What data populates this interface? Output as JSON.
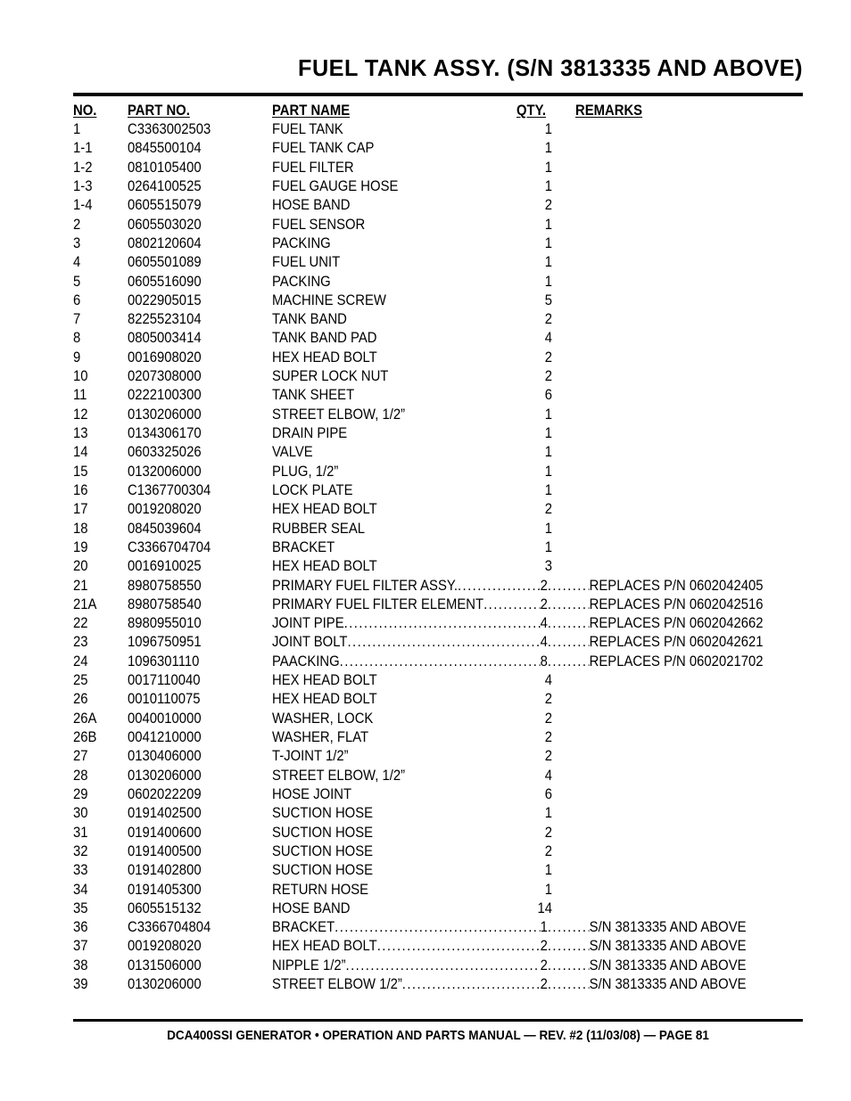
{
  "page": {
    "title": "FUEL TANK ASSY. (S/N 3813335 AND ABOVE)",
    "footer": "DCA400SSI GENERATOR • OPERATION AND PARTS MANUAL — REV. #2 (11/03/08) — PAGE 81"
  },
  "table": {
    "headers": {
      "no": "NO.",
      "part_no": "PART NO.",
      "part_name": "PART NAME",
      "qty": "QTY.",
      "remarks": "REMARKS"
    },
    "rows": [
      {
        "no": "1",
        "part_no": "C3363002503",
        "part_name": "FUEL TANK",
        "qty": "1",
        "remarks": ""
      },
      {
        "no": "1-1",
        "part_no": "0845500104",
        "part_name": "FUEL TANK CAP",
        "qty": "1",
        "remarks": ""
      },
      {
        "no": "1-2",
        "part_no": "0810105400",
        "part_name": "FUEL FILTER",
        "qty": "1",
        "remarks": ""
      },
      {
        "no": "1-3",
        "part_no": "0264100525",
        "part_name": "FUEL GAUGE HOSE",
        "qty": "1",
        "remarks": ""
      },
      {
        "no": "1-4",
        "part_no": "0605515079",
        "part_name": "HOSE BAND",
        "qty": "2",
        "remarks": ""
      },
      {
        "no": "2",
        "part_no": "0605503020",
        "part_name": "FUEL SENSOR",
        "qty": "1",
        "remarks": ""
      },
      {
        "no": "3",
        "part_no": "0802120604",
        "part_name": "PACKING",
        "qty": "1",
        "remarks": ""
      },
      {
        "no": "4",
        "part_no": "0605501089",
        "part_name": "FUEL UNIT",
        "qty": "1",
        "remarks": ""
      },
      {
        "no": "5",
        "part_no": "0605516090",
        "part_name": "PACKING",
        "qty": "1",
        "remarks": ""
      },
      {
        "no": "6",
        "part_no": "0022905015",
        "part_name": "MACHINE SCREW",
        "qty": "5",
        "remarks": ""
      },
      {
        "no": "7",
        "part_no": "8225523104",
        "part_name": "TANK BAND",
        "qty": "2",
        "remarks": ""
      },
      {
        "no": "8",
        "part_no": "0805003414",
        "part_name": "TANK BAND PAD",
        "qty": "4",
        "remarks": ""
      },
      {
        "no": "9",
        "part_no": "0016908020",
        "part_name": "HEX HEAD BOLT",
        "qty": "2",
        "remarks": ""
      },
      {
        "no": "10",
        "part_no": "0207308000",
        "part_name": "SUPER LOCK NUT",
        "qty": "2",
        "remarks": ""
      },
      {
        "no": "11",
        "part_no": "0222100300",
        "part_name": "TANK SHEET",
        "qty": "6",
        "remarks": ""
      },
      {
        "no": "12",
        "part_no": "0130206000",
        "part_name": "STREET ELBOW, 1/2”",
        "qty": "1",
        "remarks": ""
      },
      {
        "no": "13",
        "part_no": "0134306170",
        "part_name": "DRAIN PIPE",
        "qty": "1",
        "remarks": ""
      },
      {
        "no": "14",
        "part_no": "0603325026",
        "part_name": "VALVE",
        "qty": "1",
        "remarks": ""
      },
      {
        "no": "15",
        "part_no": "0132006000",
        "part_name": "PLUG, 1/2”",
        "qty": "1",
        "remarks": ""
      },
      {
        "no": "16",
        "part_no": "C1367700304",
        "part_name": "LOCK PLATE",
        "qty": "1",
        "remarks": ""
      },
      {
        "no": "17",
        "part_no": "0019208020",
        "part_name": "HEX HEAD BOLT",
        "qty": "2",
        "remarks": ""
      },
      {
        "no": "18",
        "part_no": "0845039604",
        "part_name": "RUBBER SEAL",
        "qty": "1",
        "remarks": ""
      },
      {
        "no": "19",
        "part_no": "C3366704704",
        "part_name": "BRACKET",
        "qty": "1",
        "remarks": ""
      },
      {
        "no": "20",
        "part_no": "0016910025",
        "part_name": "HEX HEAD BOLT",
        "qty": "3",
        "remarks": ""
      },
      {
        "no": "21",
        "part_no": "8980758550",
        "part_name": "PRIMARY FUEL FILTER ASSY.",
        "qty": "2",
        "remarks": "REPLACES P/N 0602042405",
        "leader": true
      },
      {
        "no": "21A",
        "part_no": "8980758540",
        "part_name": "PRIMARY FUEL FILTER ELEMENT",
        "qty": "2",
        "remarks": "REPLACES P/N 0602042516",
        "leader": true
      },
      {
        "no": "22",
        "part_no": "8980955010",
        "part_name": "JOINT PIPE",
        "qty": "4",
        "remarks": "REPLACES P/N 0602042662",
        "leader": true
      },
      {
        "no": "23",
        "part_no": "1096750951",
        "part_name": "JOINT BOLT",
        "qty": "4",
        "remarks": "REPLACES P/N 0602042621",
        "leader": true
      },
      {
        "no": "24",
        "part_no": "1096301110",
        "part_name": "PAACKING",
        "qty": "8",
        "remarks": "REPLACES P/N 0602021702",
        "leader": true
      },
      {
        "no": "25",
        "part_no": "0017110040",
        "part_name": "HEX HEAD BOLT",
        "qty": "4",
        "remarks": ""
      },
      {
        "no": "26",
        "part_no": "0010110075",
        "part_name": "HEX HEAD BOLT",
        "qty": "2",
        "remarks": ""
      },
      {
        "no": "26A",
        "part_no": "0040010000",
        "part_name": "WASHER, LOCK",
        "qty": "2",
        "remarks": ""
      },
      {
        "no": "26B",
        "part_no": "0041210000",
        "part_name": "WASHER, FLAT",
        "qty": "2",
        "remarks": ""
      },
      {
        "no": "27",
        "part_no": "0130406000",
        "part_name": "T-JOINT 1/2”",
        "qty": "2",
        "remarks": ""
      },
      {
        "no": "28",
        "part_no": "0130206000",
        "part_name": "STREET ELBOW, 1/2”",
        "qty": "4",
        "remarks": ""
      },
      {
        "no": "29",
        "part_no": "0602022209",
        "part_name": "HOSE JOINT",
        "qty": "6",
        "remarks": ""
      },
      {
        "no": "30",
        "part_no": "0191402500",
        "part_name": "SUCTION HOSE",
        "qty": "1",
        "remarks": ""
      },
      {
        "no": "31",
        "part_no": "0191400600",
        "part_name": "SUCTION HOSE",
        "qty": "2",
        "remarks": ""
      },
      {
        "no": "32",
        "part_no": "0191400500",
        "part_name": "SUCTION HOSE",
        "qty": "2",
        "remarks": ""
      },
      {
        "no": "33",
        "part_no": "0191402800",
        "part_name": "SUCTION HOSE",
        "qty": "1",
        "remarks": ""
      },
      {
        "no": "34",
        "part_no": "0191405300",
        "part_name": "RETURN HOSE",
        "qty": "1",
        "remarks": ""
      },
      {
        "no": "35",
        "part_no": "0605515132",
        "part_name": "HOSE BAND",
        "qty": "14",
        "remarks": ""
      },
      {
        "no": "36",
        "part_no": "C3366704804",
        "part_name": "BRACKET",
        "qty": "1",
        "remarks": "S/N 3813335 AND ABOVE",
        "leader": true
      },
      {
        "no": "37",
        "part_no": "0019208020",
        "part_name": "HEX HEAD BOLT",
        "qty": "2",
        "remarks": "S/N 3813335 AND ABOVE",
        "leader": true
      },
      {
        "no": "38",
        "part_no": "0131506000",
        "part_name": "NIPPLE 1/2”",
        "qty": "2",
        "remarks": "S/N 3813335 AND ABOVE",
        "leader": true
      },
      {
        "no": "39",
        "part_no": "0130206000",
        "part_name": "STREET ELBOW 1/2”",
        "qty": "2",
        "remarks": "S/N 3813335 AND ABOVE",
        "leader": true
      }
    ]
  }
}
